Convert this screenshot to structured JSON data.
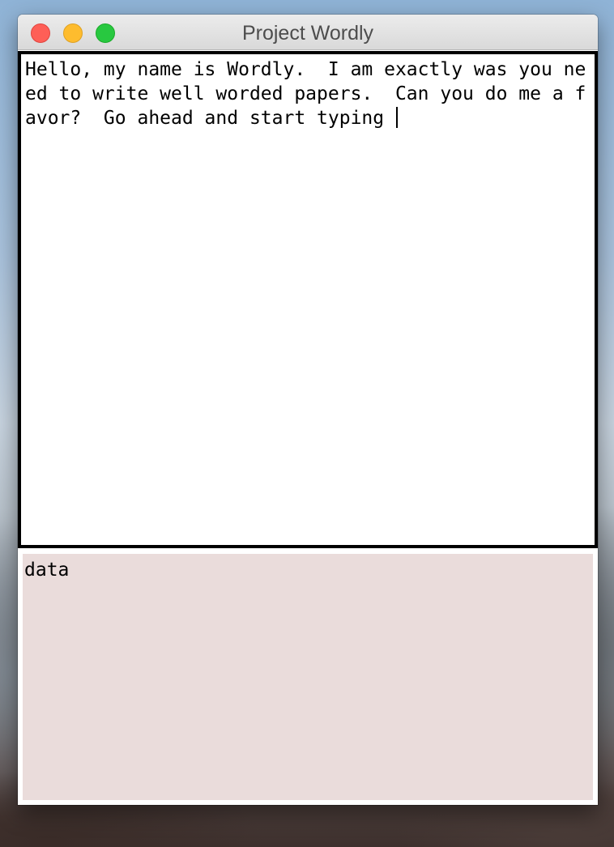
{
  "window": {
    "title": "Project Wordly"
  },
  "editor": {
    "text": "Hello, my name is Wordly.  I am exactly was you need to write well worded papers.  Can you do me a favor?  Go ahead and start typing "
  },
  "output": {
    "text": "data"
  },
  "colors": {
    "close": "#fe5f57",
    "minimize": "#febc2e",
    "zoom": "#28c840",
    "output_background": "#eadcdb",
    "editor_border": "#000000"
  }
}
